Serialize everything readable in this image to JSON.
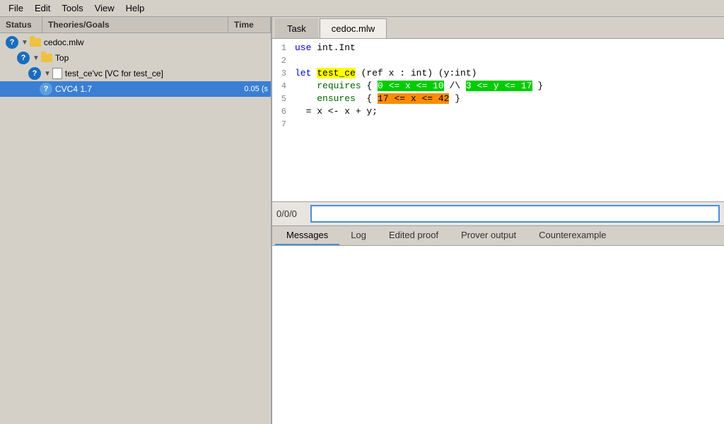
{
  "menubar": {
    "items": [
      "File",
      "Edit",
      "Tools",
      "View",
      "Help"
    ]
  },
  "left_panel": {
    "headers": {
      "status": "Status",
      "theories": "Theories/Goals",
      "time": "Time"
    },
    "tree": [
      {
        "id": "cedoc",
        "indent": 1,
        "label": "cedoc.mlw",
        "status": "question",
        "has_folder": true,
        "expanded": true,
        "time": ""
      },
      {
        "id": "top",
        "indent": 2,
        "label": "Top",
        "status": "question",
        "has_folder": true,
        "expanded": true,
        "time": ""
      },
      {
        "id": "test_ce_vc",
        "indent": 3,
        "label": "test_ce'vc [VC for test_ce]",
        "status": "question",
        "has_file": true,
        "expanded": true,
        "time": ""
      },
      {
        "id": "cvc4",
        "indent": 4,
        "label": "CVC4 1.7",
        "status": "question",
        "selected": true,
        "time": "0.05 (s"
      }
    ]
  },
  "right_panel": {
    "tabs": [
      {
        "id": "task",
        "label": "Task",
        "active": false
      },
      {
        "id": "cedoc",
        "label": "cedoc.mlw",
        "active": true
      }
    ],
    "code": {
      "lines": [
        {
          "num": "1",
          "content": "use int.Int"
        },
        {
          "num": "2",
          "content": ""
        },
        {
          "num": "3",
          "content": "let test_ce (ref x : int) (y:int)"
        },
        {
          "num": "4",
          "content": "    requires { 0 <= x <= 10 /\\ 3 <= y <= 17 }"
        },
        {
          "num": "5",
          "content": "    ensures  { 17 <= x <= 42 }"
        },
        {
          "num": "6",
          "content": "  = x <- x + y;"
        },
        {
          "num": "7",
          "content": ""
        }
      ]
    },
    "input": {
      "counter": "0/0/0",
      "placeholder": ""
    },
    "bottom_tabs": [
      {
        "id": "messages",
        "label": "Messages",
        "active": true
      },
      {
        "id": "log",
        "label": "Log",
        "active": false
      },
      {
        "id": "edited_proof",
        "label": "Edited proof",
        "active": false
      },
      {
        "id": "prover_output",
        "label": "Prover output",
        "active": false
      },
      {
        "id": "counterexample",
        "label": "Counterexample",
        "active": false
      }
    ]
  }
}
